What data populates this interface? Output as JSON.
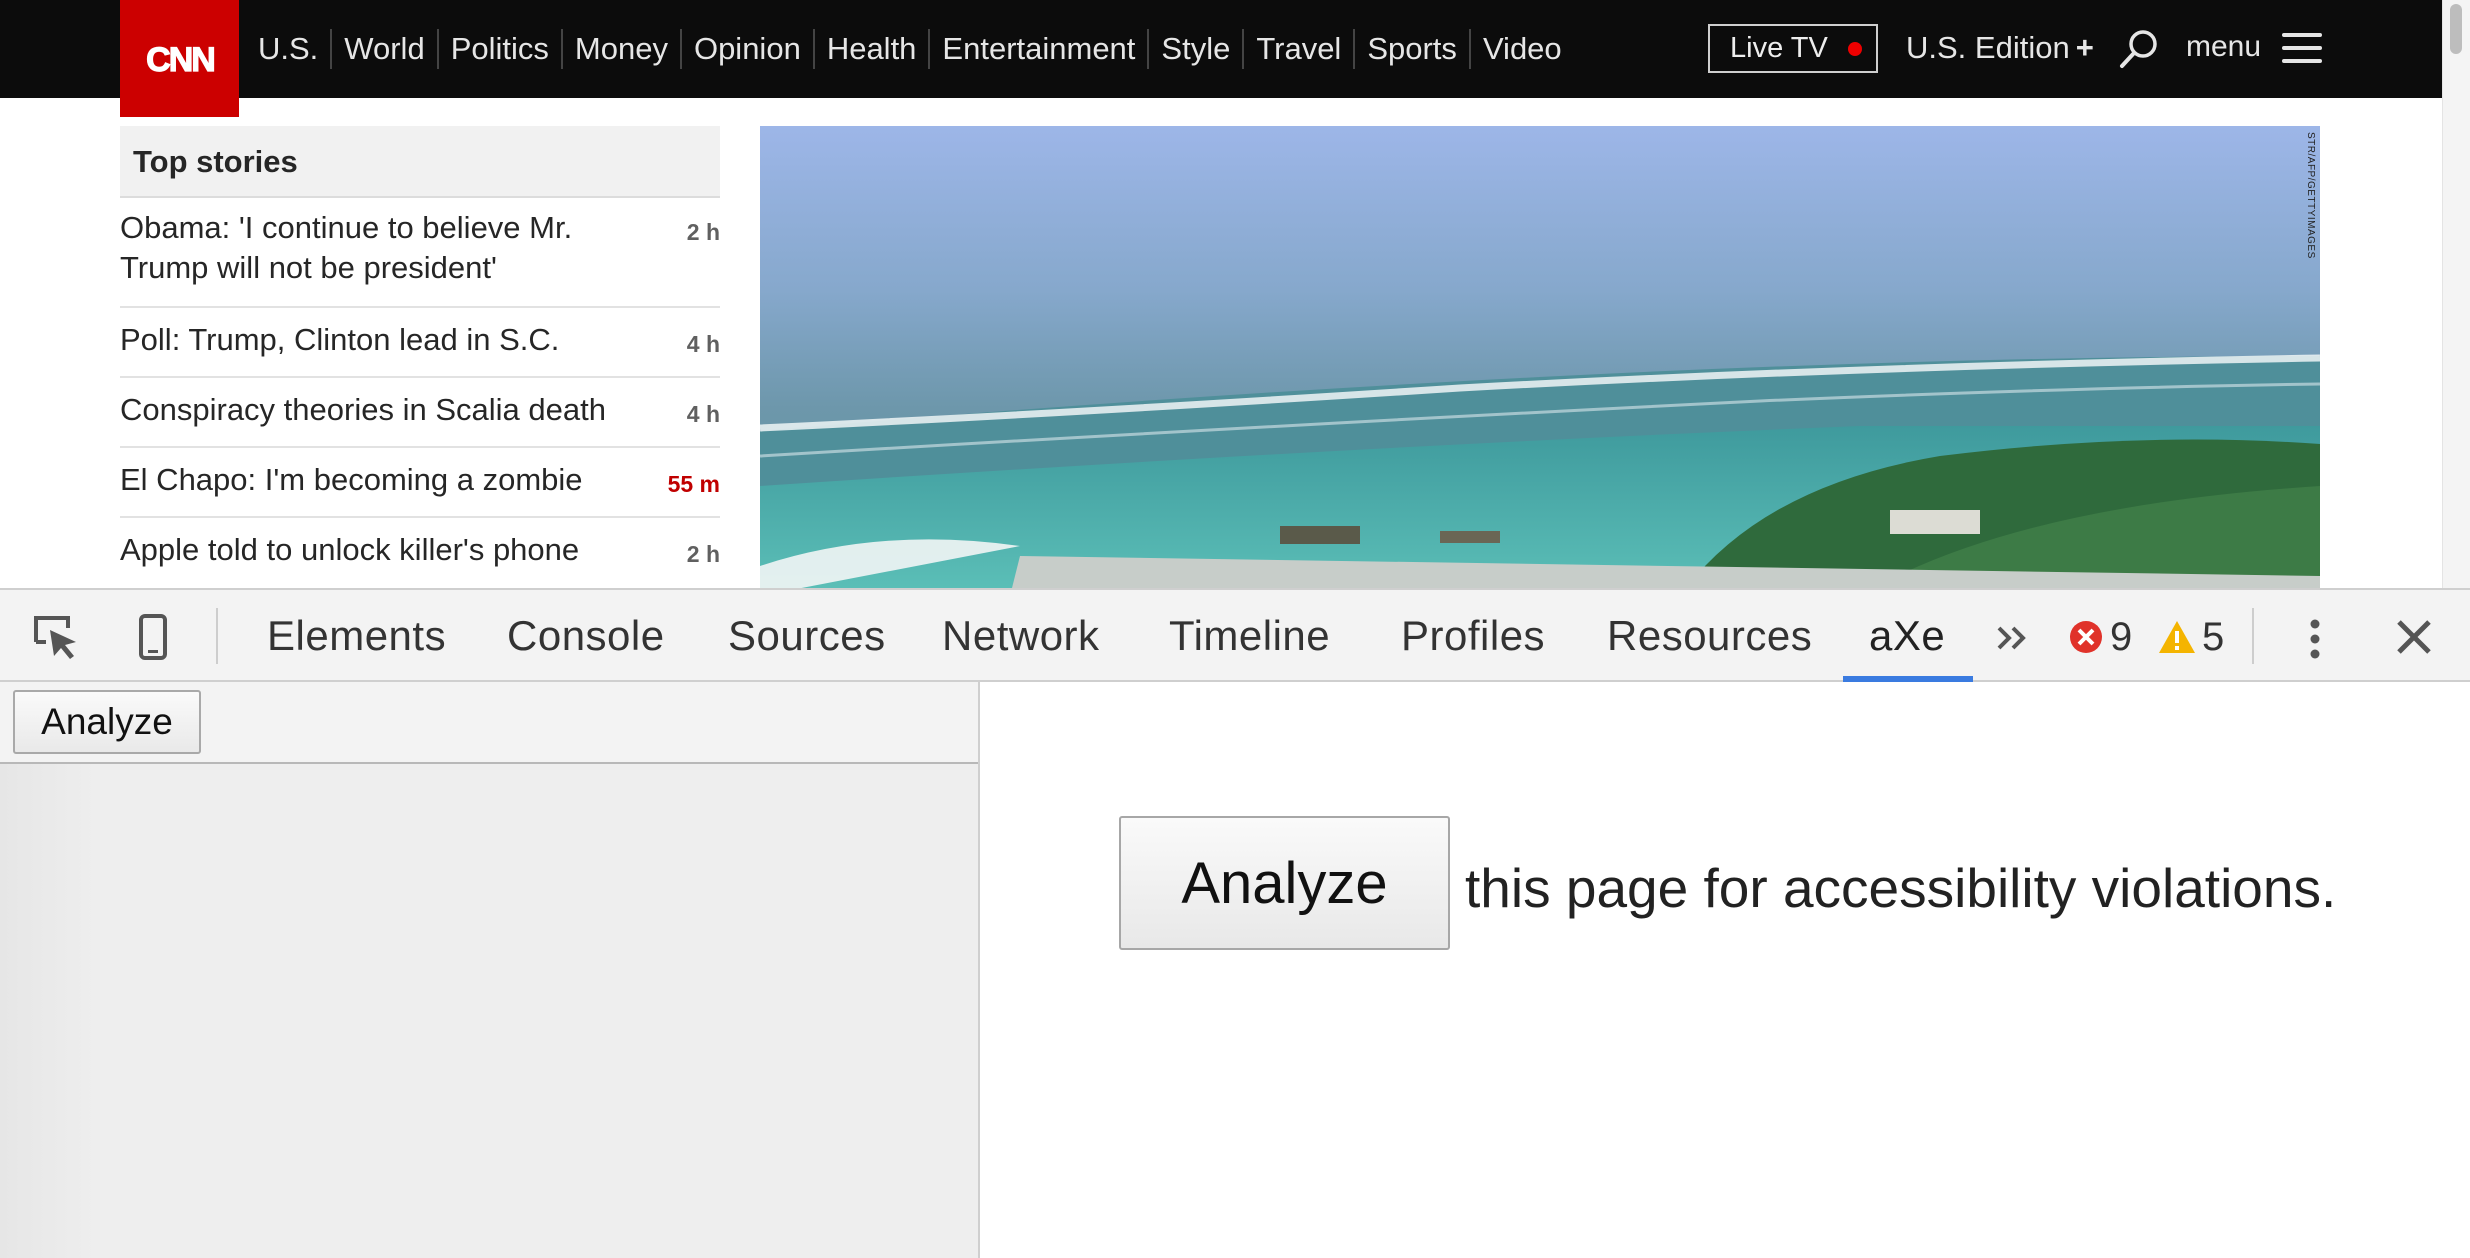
{
  "site": {
    "logo_text": "CNN",
    "brand_color": "#cc0000",
    "nav": [
      "U.S.",
      "World",
      "Politics",
      "Money",
      "Opinion",
      "Health",
      "Entertainment",
      "Style",
      "Travel",
      "Sports",
      "Video"
    ],
    "live_tv_label": "Live TV",
    "edition_label": "U.S. Edition",
    "edition_plus": "+",
    "menu_label": "menu",
    "top_stories": {
      "heading": "Top stories",
      "items": [
        {
          "title": "Obama: 'I continue to believe Mr. Trump will not be president'",
          "time": "2 h"
        },
        {
          "title": "Poll: Trump, Clinton lead in S.C.",
          "time": "4 h"
        },
        {
          "title": "Conspiracy theories in Scalia death",
          "time": "4 h"
        },
        {
          "title": "El Chapo: I'm becoming a zombie",
          "time": "55 m"
        },
        {
          "title": "Apple told to unlock killer's phone",
          "time": "2 h"
        }
      ]
    },
    "photo_credit": "STR/AFP/GETTYIMAGES"
  },
  "devtools": {
    "tabs": [
      "Elements",
      "Console",
      "Sources",
      "Network",
      "Timeline",
      "Profiles",
      "Resources",
      "aXe"
    ],
    "active_tab": "aXe",
    "error_count": "9",
    "warning_count": "5",
    "accent_color": "#3a7be0",
    "axe": {
      "sidebar_button": "Analyze",
      "main_button": "Analyze",
      "main_text": "this page for accessibility violations."
    }
  }
}
